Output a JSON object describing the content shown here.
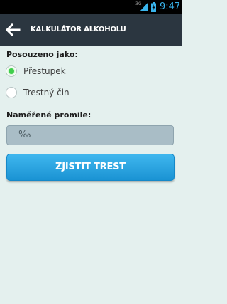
{
  "status_bar": {
    "network": "3G",
    "clock": "9:47",
    "signal_icon": "signal-icon",
    "battery_icon": "battery-charging-icon"
  },
  "app_bar": {
    "back_icon": "arrow-left-icon",
    "title": "KALKULÁTOR ALKOHOLU"
  },
  "form": {
    "classification_label": "Posouzeno jako:",
    "options": [
      {
        "label": "Přestupek",
        "selected": true
      },
      {
        "label": "Trestný čin",
        "selected": false
      }
    ],
    "promile_label": "Naměřené promile:",
    "promile_placeholder": "‰",
    "submit_label": "ZJISTIT TREST"
  },
  "colors": {
    "app_bar": "#2b3640",
    "background": "#e4f0ee",
    "accent": "#1a93d3",
    "radio_selected": "#3fce4b"
  }
}
